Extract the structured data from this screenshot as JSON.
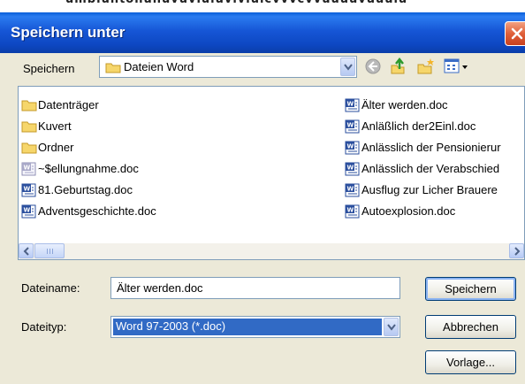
{
  "background": {
    "partial_text": "umbiuntonunuvuviuiuviviuicvvvcvvuuuuvuuulu"
  },
  "window": {
    "title": "Speichern unter"
  },
  "location": {
    "label": "Speichern",
    "current_folder": "Dateien Word"
  },
  "toolbar": {
    "icons": [
      "back-icon",
      "up-folder-icon",
      "new-folder-icon",
      "view-menu-icon"
    ]
  },
  "files": {
    "column1": [
      {
        "name": "Datenträger",
        "type": "folder"
      },
      {
        "name": "Kuvert",
        "type": "folder"
      },
      {
        "name": "Ordner",
        "type": "folder"
      },
      {
        "name": "~$ellungnahme.doc",
        "type": "doc-temp"
      },
      {
        "name": "81.Geburtstag.doc",
        "type": "doc"
      },
      {
        "name": "Adventsgeschichte.doc",
        "type": "doc"
      }
    ],
    "column2": [
      {
        "name": "Älter werden.doc",
        "type": "doc"
      },
      {
        "name": "Anläßlich der2Einl.doc",
        "type": "doc"
      },
      {
        "name": "Anlässlich der Pensionierur",
        "type": "doc"
      },
      {
        "name": "Anlässlich der Verabschied",
        "type": "doc"
      },
      {
        "name": "Ausflug zur Licher Brauere",
        "type": "doc"
      },
      {
        "name": "Autoexplosion.doc",
        "type": "doc"
      }
    ]
  },
  "form": {
    "filename_label": "Dateiname:",
    "filename_value": "Älter werden.doc",
    "filetype_label": "Dateityp:",
    "filetype_value": "Word 97-2003 (*.doc)"
  },
  "buttons": {
    "save": "Speichern",
    "cancel": "Abbrechen",
    "template": "Vorlage..."
  },
  "colors": {
    "titlebar": "#0d47c2",
    "selection": "#316ac5",
    "dialog_bg": "#ece9d8"
  }
}
